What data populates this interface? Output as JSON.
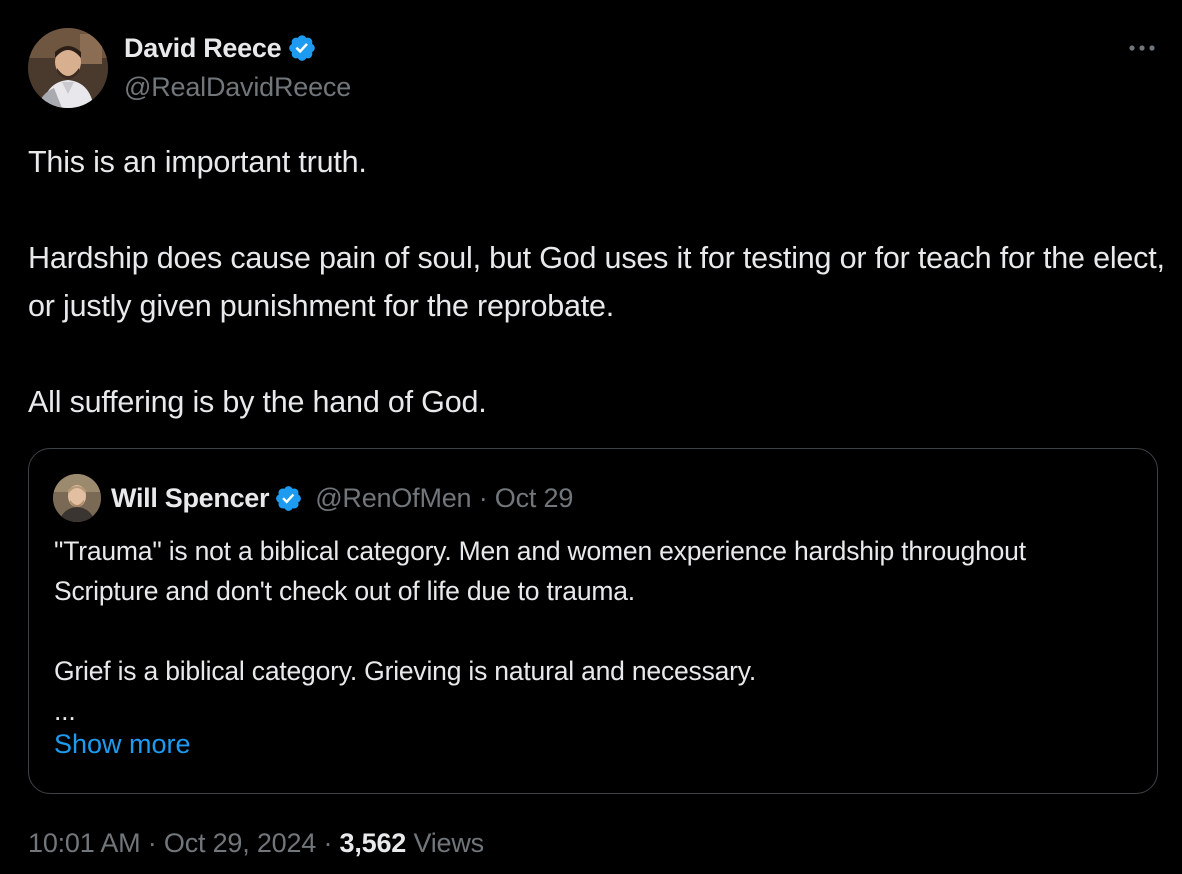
{
  "author": {
    "name": "David Reece",
    "handle": "@RealDavidReece",
    "verified": true
  },
  "tweet": {
    "paragraphs": [
      "This is an important truth.",
      "Hardship does cause pain of soul, but God uses it for testing or for teach for the elect, or justly given punishment for the reprobate.",
      "All suffering is by the hand of God."
    ]
  },
  "quote": {
    "name": "Will Spencer",
    "handle": "@RenOfMen",
    "separator": "·",
    "date": "Oct 29",
    "paragraphs": [
      "\"Trauma\" is not a biblical category. Men and women experience hardship throughout Scripture and don't check out of life due to trauma.",
      "Grief is a biblical category. Grieving is natural and necessary.",
      "..."
    ],
    "show_more_label": "Show more"
  },
  "footer": {
    "time": "10:01 AM",
    "date": "Oct 29, 2024",
    "separator": "·",
    "views_count": "3,562",
    "views_label": "Views"
  },
  "icons": {
    "more": "more-horizontal-icon",
    "verified": "verified-badge-icon"
  },
  "colors": {
    "background": "#000000",
    "text": "#e7e9ea",
    "secondary": "#71767b",
    "accent": "#1d9bf0",
    "border": "#3e4144"
  }
}
